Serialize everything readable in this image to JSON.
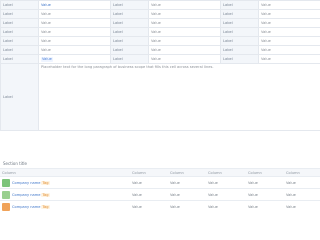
{
  "rows": [
    {
      "l1": "Label",
      "v1": "Value",
      "l2": "Label",
      "v2": "Value",
      "l3": "Label",
      "v3": "Value"
    },
    {
      "l1": "Label",
      "v1": "Value",
      "l2": "Label",
      "v2": "Value",
      "l3": "Label",
      "v3": "Value"
    },
    {
      "l1": "Label",
      "v1": "Value",
      "l2": "Label",
      "v2": "Value",
      "l3": "Label",
      "v3": "Value"
    },
    {
      "l1": "Label",
      "v1": "Value",
      "l2": "Label",
      "v2": "Value",
      "l3": "Label",
      "v3": "Value"
    },
    {
      "l1": "Label",
      "v1": "Value",
      "l2": "Label",
      "v2": "Value",
      "l3": "Label",
      "v3": "Value"
    },
    {
      "l1": "Label",
      "v1": "Value",
      "l2": "Label",
      "v2": "Value",
      "l3": "Label",
      "v3": "Value"
    },
    {
      "l1": "Label",
      "v1": "Value",
      "l2": "Label",
      "v2": "Value",
      "l3": "Label",
      "v3": "Value"
    }
  ],
  "scope": {
    "label": "Label",
    "text": "Placeholder text for the long paragraph of business scope that fills this cell across several lines."
  },
  "investments": {
    "title": "Section title",
    "headers": [
      "Column",
      "Column",
      "Column",
      "Column",
      "Column",
      "Column"
    ],
    "rows": [
      {
        "name": "Company name",
        "tag": "Tag",
        "c2": "Value",
        "c3": "Value",
        "c4": "Value",
        "c5": "Value",
        "c6": "Value"
      },
      {
        "name": "Company name",
        "tag": "Tag",
        "c2": "Value",
        "c3": "Value",
        "c4": "Value",
        "c5": "Value",
        "c6": "Value"
      },
      {
        "name": "Company name",
        "tag": "Tag",
        "c2": "Value",
        "c3": "Value",
        "c4": "Value",
        "c5": "Value",
        "c6": "Value"
      }
    ]
  },
  "logo_colors": [
    "#7cc47a",
    "#9ad08f",
    "#f0a35a"
  ]
}
